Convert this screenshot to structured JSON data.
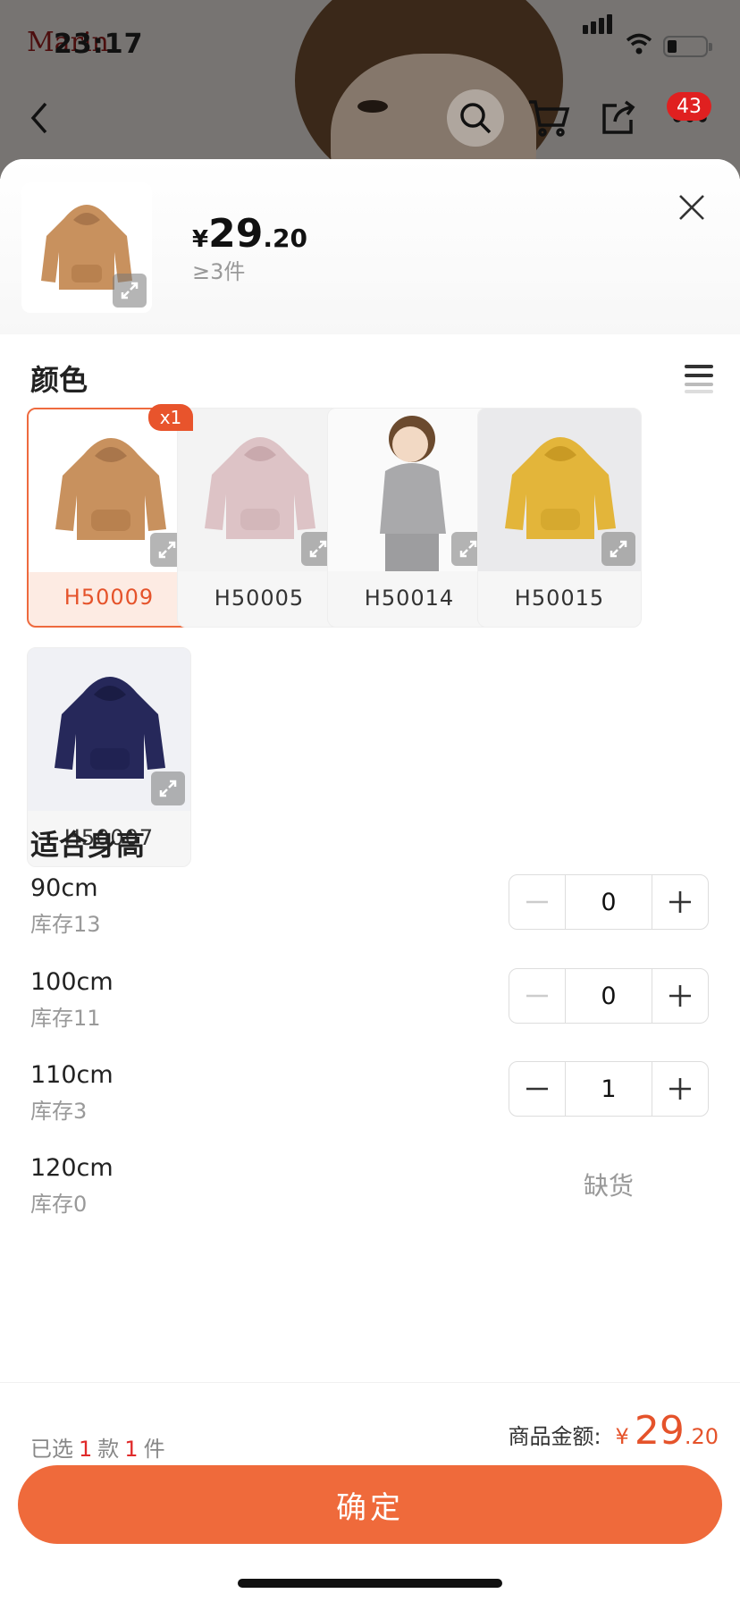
{
  "status_bar": {
    "time": "23:17",
    "brand_watermark": "Marin"
  },
  "nav": {
    "cart_badge": "43"
  },
  "sheet": {
    "price": {
      "currency": "¥",
      "integer": "29",
      "decimal": ".20"
    },
    "moq": "≥3件"
  },
  "color_section": {
    "title": "颜色",
    "selected_badge": "x1",
    "items": [
      {
        "code": "H50009",
        "swatch": "#c8915e",
        "selected": true
      },
      {
        "code": "H50005",
        "swatch": "#ddc3c6",
        "selected": false
      },
      {
        "code": "H50014",
        "swatch": "#a9a9ab",
        "selected": false
      },
      {
        "code": "H50015",
        "swatch": "#e3b53a",
        "selected": false
      },
      {
        "code": "H50007",
        "swatch": "#26285a",
        "selected": false
      }
    ]
  },
  "size_section": {
    "title": "适合身高",
    "rows": [
      {
        "size": "90cm",
        "stock": "库存13",
        "qty": "0"
      },
      {
        "size": "100cm",
        "stock": "库存11",
        "qty": "0"
      },
      {
        "size": "110cm",
        "stock": "库存3",
        "qty": "1"
      },
      {
        "size": "120cm",
        "stock": "库存0",
        "sold_out": "缺货"
      }
    ]
  },
  "footer": {
    "chosen_prefix": "已选",
    "chosen_styles": "1",
    "chosen_styles_unit": "款",
    "chosen_items": "1",
    "chosen_items_unit": "件",
    "total_label": "商品金额:",
    "total_currency": "¥",
    "total_integer": "29",
    "total_decimal": ".20",
    "confirm_label": "确定"
  },
  "colors": {
    "accent": "#ef6a3b",
    "price_red": "#e5532b"
  }
}
